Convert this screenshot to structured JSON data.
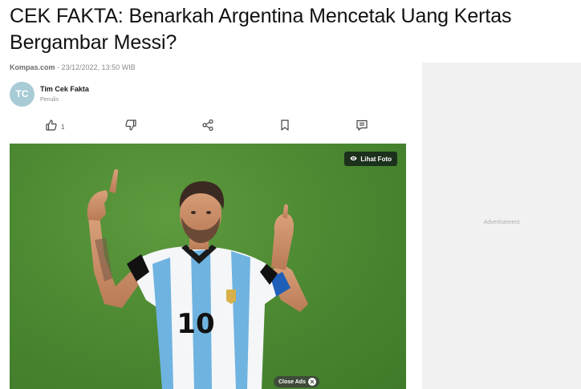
{
  "article": {
    "title": "CEK FAKTA: Benarkah Argentina Mencetak Uang Kertas Bergambar Messi?",
    "source": "Kompas.com",
    "date_sep": " - ",
    "datetime": "23/12/2022, 13:50 WIB"
  },
  "author": {
    "initials": "TC",
    "name": "Tim Cek Fakta",
    "role": "Penulis"
  },
  "actions": {
    "like_count": "1",
    "icons": [
      "thumbs-up-icon",
      "thumbs-down-icon",
      "share-icon",
      "bookmark-icon",
      "comment-icon"
    ]
  },
  "photo": {
    "view_label": "Lihat Foto",
    "jersey_number": "10",
    "close_ads_label": "Close Ads"
  },
  "sidebar": {
    "ad_label": "Advertisement"
  },
  "colors": {
    "pitch": "#4d8a32",
    "avatar": "#a8cbd6",
    "ad_background": "#f1f1f1"
  }
}
